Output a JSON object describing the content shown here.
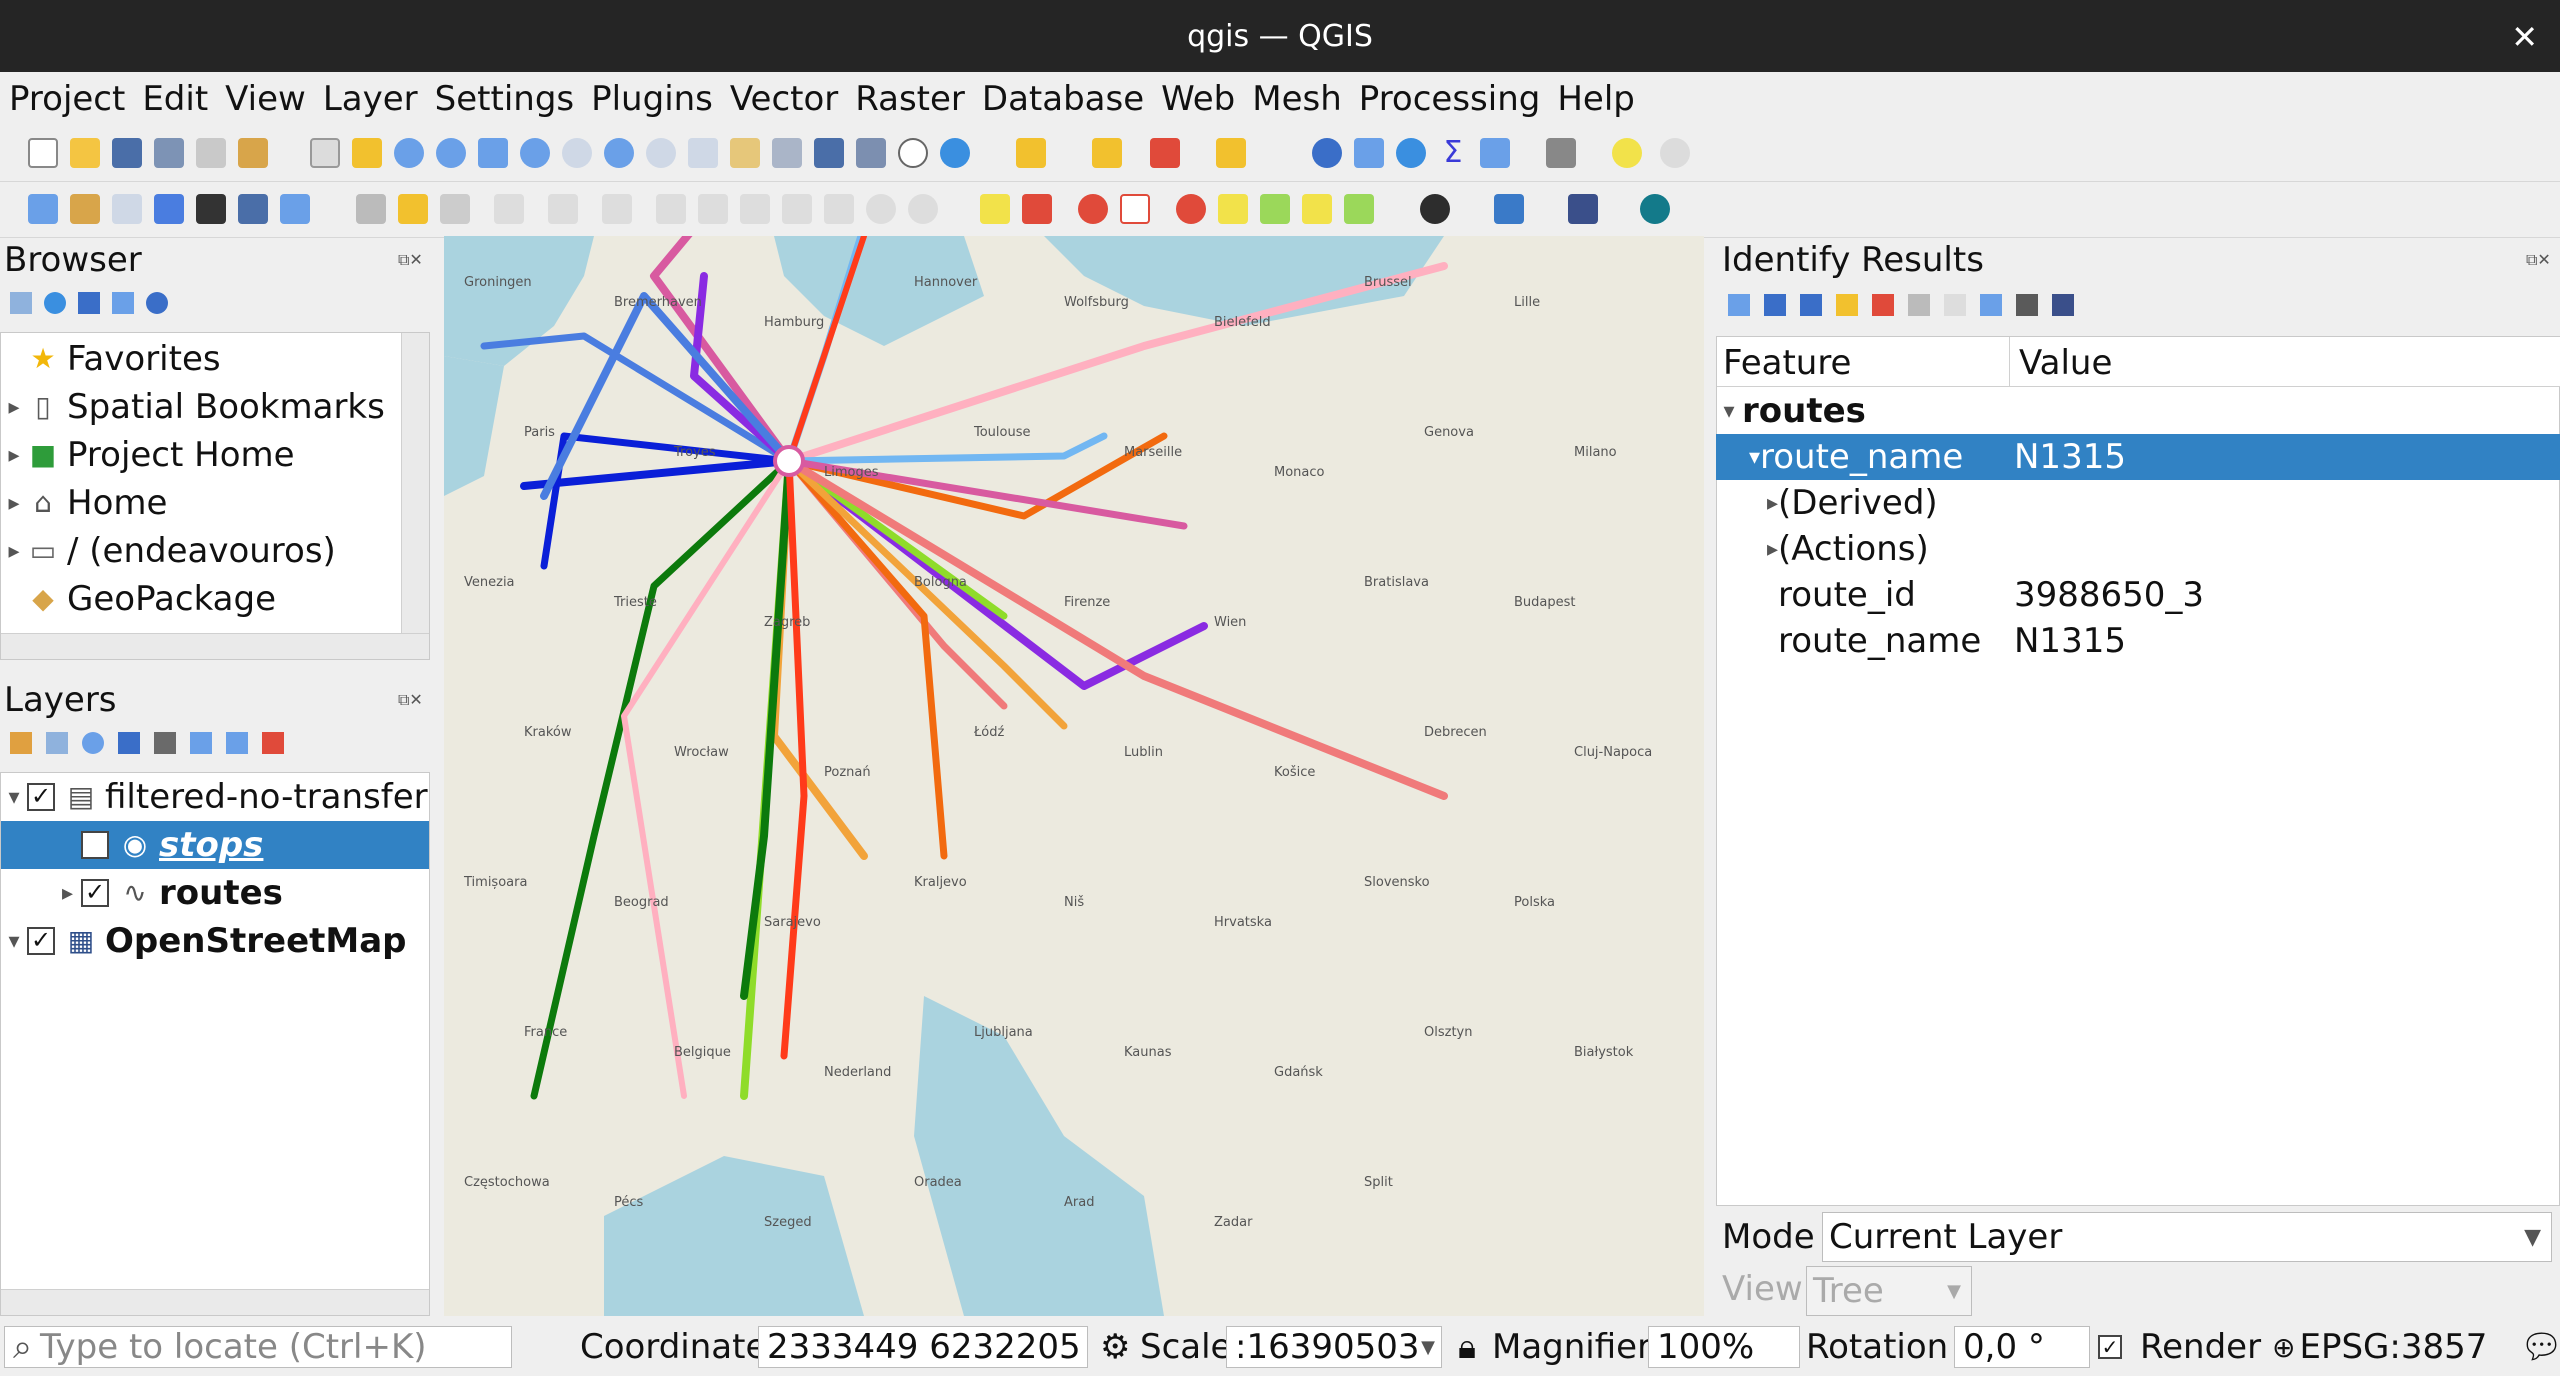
{
  "window": {
    "title": "qgis — QGIS",
    "close": "✕"
  },
  "menu": [
    "Project",
    "Edit",
    "View",
    "Layer",
    "Settings",
    "Plugins",
    "Vector",
    "Raster",
    "Database",
    "Web",
    "Mesh",
    "Processing",
    "Help"
  ],
  "browser": {
    "title": "Browser",
    "items": [
      {
        "label": "Favorites",
        "icon": "star-icon"
      },
      {
        "label": "Spatial Bookmarks",
        "icon": "bookmark-icon"
      },
      {
        "label": "Project Home",
        "icon": "project-home-icon"
      },
      {
        "label": "Home",
        "icon": "home-icon"
      },
      {
        "label": "/ (endeavouros)",
        "icon": "folder-icon"
      },
      {
        "label": "GeoPackage",
        "icon": "geopackage-icon"
      }
    ]
  },
  "layers": {
    "title": "Layers",
    "items": [
      {
        "label": "filtered-no-transfer",
        "checked": true
      },
      {
        "label": "stops",
        "checked": false
      },
      {
        "label": "routes",
        "checked": true
      },
      {
        "label": "OpenStreetMap",
        "checked": true
      }
    ]
  },
  "identify": {
    "title": "Identify Results",
    "col_feature": "Feature",
    "col_value": "Value",
    "layer": "routes",
    "rows": [
      {
        "feature": "route_name",
        "value": "N1315"
      },
      {
        "feature": "(Derived)",
        "value": ""
      },
      {
        "feature": "(Actions)",
        "value": ""
      },
      {
        "feature": "route_id",
        "value": "3988650_3"
      },
      {
        "feature": "route_name",
        "value": "N1315"
      }
    ],
    "mode_label": "Mode",
    "mode_value": "Current Layer",
    "view_label": "View",
    "view_value": "Tree"
  },
  "status": {
    "locator_placeholder": "Type to locate (Ctrl+K)",
    "coordinate_label": "Coordinate",
    "coordinate_value": "2333449  6232205",
    "scale_label": "Scale",
    "scale_value": ":16390503",
    "magnifier_label": "Magnifier",
    "magnifier_value": "100%",
    "rotation_label": "Rotation",
    "rotation_value": "0,0 °",
    "render_label": "Render",
    "crs": "EPSG:3857"
  },
  "map": {
    "labels": [
      "Groningen",
      "Bremerhaven",
      "Hamburg",
      "Hannover",
      "Wolfsburg",
      "Bielefeld",
      "Brussel",
      "Lille",
      "Paris",
      "Troyes",
      "Limoges",
      "Toulouse",
      "Marseille",
      "Monaco",
      "Genova",
      "Milano",
      "Venezia",
      "Trieste",
      "Zagreb",
      "Bologna",
      "Firenze",
      "Wien",
      "Bratislava",
      "Budapest",
      "Kraków",
      "Wrocław",
      "Poznań",
      "Łódź",
      "Lublin",
      "Košice",
      "Debrecen",
      "Cluj-Napoca",
      "Timișoara",
      "Beograd",
      "Sarajevo",
      "Kraljevo",
      "Niš",
      "Hrvatska",
      "Slovensko",
      "Polska",
      "France",
      "Belgique",
      "Nederland",
      "Ljubljana",
      "Kaunas",
      "Gdańsk",
      "Olsztyn",
      "Białystok",
      "Częstochowa",
      "Pécs",
      "Szeged",
      "Oradea",
      "Arad",
      "Zadar",
      "Split"
    ],
    "route_colors": [
      "#0a1fd8",
      "#f26a0f",
      "#8a2be2",
      "#8fdc2a",
      "#0c7a0c",
      "#f2a33a",
      "#f07a7a",
      "#72b7f2",
      "#d85aa0",
      "#4a7de0",
      "#ff3b1a",
      "#ffb0c0"
    ]
  }
}
